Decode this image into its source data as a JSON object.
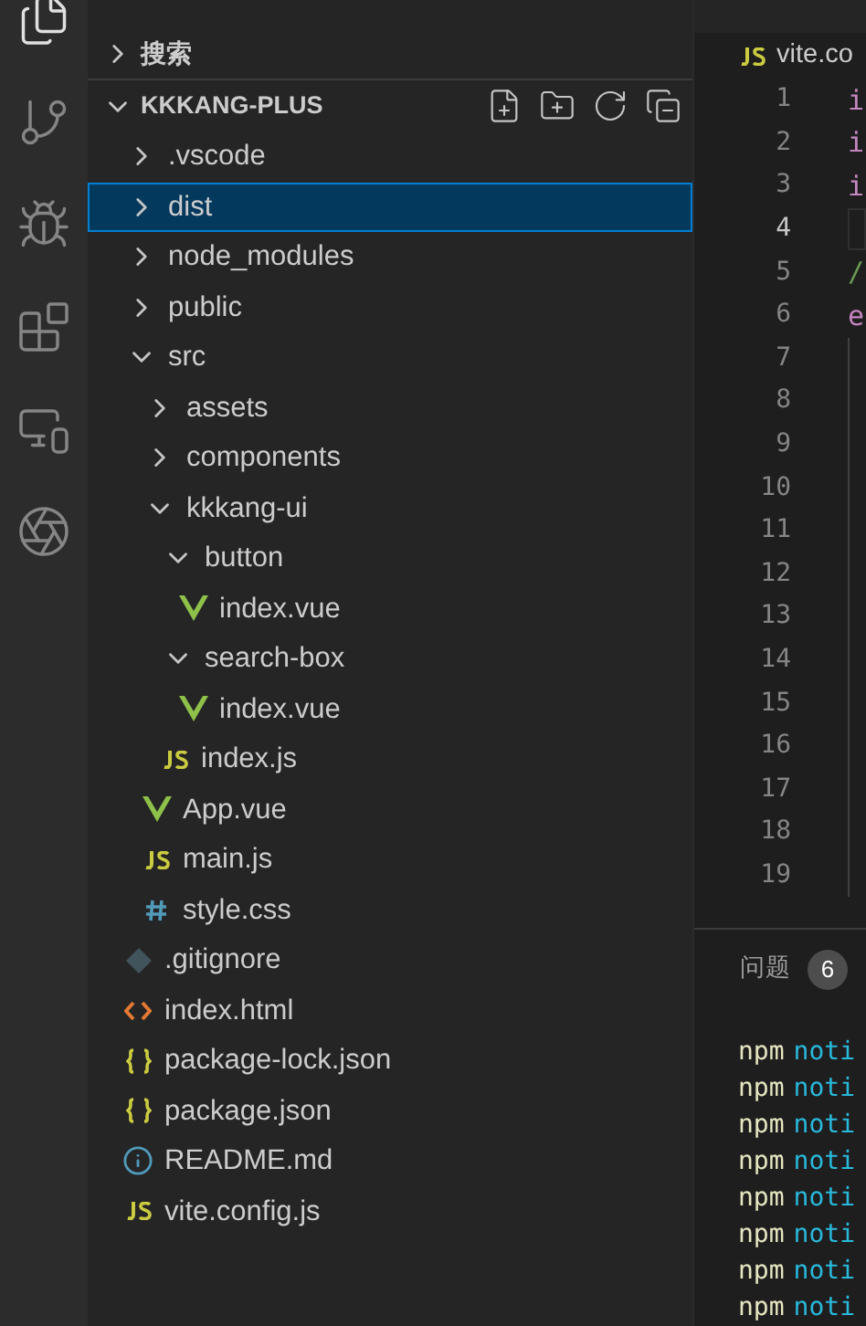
{
  "activity_bar": {
    "items": [
      {
        "kind": "explorer",
        "selected": true
      },
      {
        "kind": "source-control",
        "selected": false
      },
      {
        "kind": "debug",
        "selected": false
      },
      {
        "kind": "extensions",
        "selected": false
      },
      {
        "kind": "remote",
        "selected": false
      },
      {
        "kind": "ai",
        "selected": false
      }
    ]
  },
  "sidebar": {
    "search_section": {
      "title": "搜索",
      "expanded": false
    },
    "project": {
      "title": "KKKANG-PLUS",
      "expanded": true
    },
    "tree": [
      {
        "name": ".vscode",
        "kind": "folder",
        "expanded": false,
        "selected": false
      },
      {
        "name": "dist",
        "kind": "folder",
        "expanded": false,
        "selected": true
      },
      {
        "name": "node_modules",
        "kind": "folder",
        "expanded": false,
        "selected": false
      },
      {
        "name": "public",
        "kind": "folder",
        "expanded": false,
        "selected": false
      },
      {
        "name": "src",
        "kind": "folder",
        "expanded": true,
        "selected": false,
        "children": [
          {
            "name": "assets",
            "kind": "folder",
            "expanded": false,
            "selected": false
          },
          {
            "name": "components",
            "kind": "folder",
            "expanded": false,
            "selected": false
          },
          {
            "name": "kkkang-ui",
            "kind": "folder",
            "expanded": true,
            "selected": false,
            "children": [
              {
                "name": "button",
                "kind": "folder",
                "expanded": true,
                "selected": false,
                "children": [
                  {
                    "name": "index.vue",
                    "kind": "vue",
                    "selected": false
                  }
                ]
              },
              {
                "name": "search-box",
                "kind": "folder",
                "expanded": true,
                "selected": false,
                "children": [
                  {
                    "name": "index.vue",
                    "kind": "vue",
                    "selected": false
                  }
                ]
              },
              {
                "name": "index.js",
                "kind": "js",
                "selected": false
              }
            ]
          },
          {
            "name": "App.vue",
            "kind": "vue",
            "selected": false
          },
          {
            "name": "main.js",
            "kind": "js",
            "selected": false
          },
          {
            "name": "style.css",
            "kind": "css",
            "selected": false
          }
        ]
      },
      {
        "name": ".gitignore",
        "kind": "git",
        "selected": false
      },
      {
        "name": "index.html",
        "kind": "html",
        "selected": false
      },
      {
        "name": "package-lock.json",
        "kind": "json",
        "selected": false
      },
      {
        "name": "package.json",
        "kind": "json",
        "selected": false
      },
      {
        "name": "README.md",
        "kind": "info",
        "selected": false
      },
      {
        "name": "vite.config.js",
        "kind": "js",
        "selected": false
      }
    ]
  },
  "editor": {
    "tab": {
      "label": "vite.co",
      "kind": "js"
    },
    "lines": [
      {
        "number": "1",
        "text": "i",
        "kind": "keyword",
        "current": false
      },
      {
        "number": "2",
        "text": "i",
        "kind": "keyword",
        "current": false
      },
      {
        "number": "3",
        "text": "i",
        "kind": "keyword",
        "current": false
      },
      {
        "number": "4",
        "current": true
      },
      {
        "number": "5",
        "text": "/",
        "kind": "comment",
        "current": false
      },
      {
        "number": "6",
        "text": "e",
        "kind": "keyword",
        "current": false
      },
      {
        "number": "7",
        "current": false
      },
      {
        "number": "8",
        "current": false
      },
      {
        "number": "9",
        "current": false
      },
      {
        "number": "10",
        "current": false
      },
      {
        "number": "11",
        "current": false
      },
      {
        "number": "12",
        "current": false
      },
      {
        "number": "13",
        "current": false
      },
      {
        "number": "14",
        "current": false
      },
      {
        "number": "15",
        "current": false
      },
      {
        "number": "16",
        "current": false
      },
      {
        "number": "17",
        "current": false
      },
      {
        "number": "18",
        "current": false
      },
      {
        "number": "19",
        "current": false
      }
    ]
  },
  "panel": {
    "tab": {
      "label": "问题",
      "badge": "6"
    },
    "terminal_lines": [
      {
        "command": "npm",
        "text": "noti"
      },
      {
        "command": "npm",
        "text": "noti"
      },
      {
        "command": "npm",
        "text": "noti"
      },
      {
        "command": "npm",
        "text": "noti"
      },
      {
        "command": "npm",
        "text": "noti"
      },
      {
        "command": "npm",
        "text": "noti"
      },
      {
        "command": "npm",
        "text": "noti"
      },
      {
        "command": "npm",
        "text": "noti"
      }
    ]
  }
}
